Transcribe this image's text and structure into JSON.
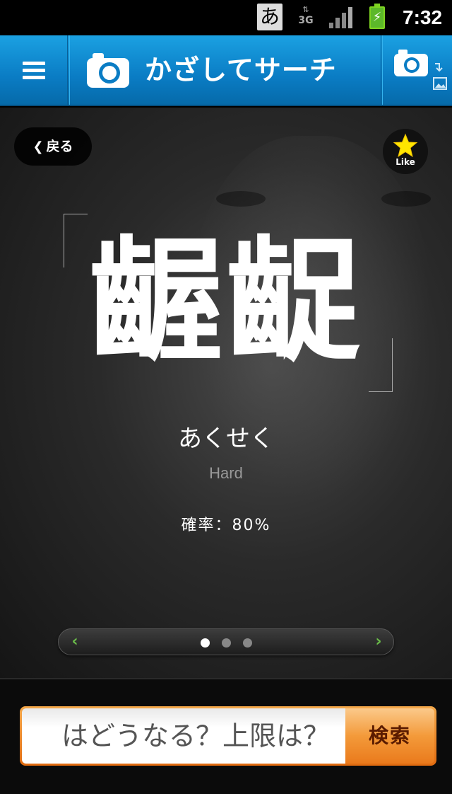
{
  "status_bar": {
    "ime_indicator": "あ",
    "network": "3G",
    "time": "7:32"
  },
  "header": {
    "title": "かざしてサーチ",
    "icons": {
      "menu": "menu-icon",
      "brand": "camera-icon",
      "switch": "camera-switch-icon"
    }
  },
  "main": {
    "back_label": "戻る",
    "like_label": "Like",
    "word": "齷齪",
    "reading": "あくせく",
    "difficulty": "Hard",
    "probability": "確率：80%",
    "pager": {
      "page_count": 3,
      "current_page": 1
    }
  },
  "search": {
    "input_value": "はどうなる？上限は？",
    "button_label": "検索"
  },
  "colors": {
    "header_blue": "#0a7cc4",
    "accent_orange": "#ea7a1c",
    "like_star": "#ffe600",
    "pager_arrow": "#6cc04a"
  }
}
